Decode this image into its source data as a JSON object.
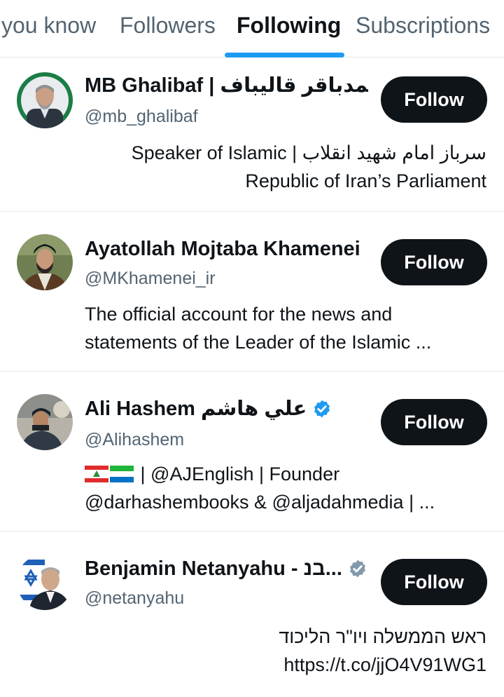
{
  "tabs": [
    {
      "label": "you know",
      "active": false
    },
    {
      "label": "Followers",
      "active": false
    },
    {
      "label": "Following",
      "active": true
    },
    {
      "label": "Subscriptions",
      "active": false
    }
  ],
  "colors": {
    "accent": "#1d9bf0",
    "text": "#0f1419",
    "secondary": "#536471",
    "button": "#0f1419",
    "divider": "#e6e9eb"
  },
  "accounts": [
    {
      "name": "MB Ghalibaf | محمدباقر قالیباف",
      "handle": "@mb_ghalibaf",
      "verified": false,
      "bio_lines": [
        "Speaker of Islamic | سرباز امام شهيد انقلاب",
        "Republic of Iran’s Parliament"
      ],
      "follow_label": "Follow"
    },
    {
      "name": "Ayatollah Mojtaba Khamenei",
      "handle": "@MKhamenei_ir",
      "verified": false,
      "bio_lines": [
        "The official account for the news and",
        "statements of the Leader of the Islamic ..."
      ],
      "follow_label": "Follow"
    },
    {
      "name": "Ali Hashem علي هاشم",
      "handle": "@Alihashem",
      "verified": true,
      "bio_flags": [
        "lebanon-flag",
        "sierra-leone-flag"
      ],
      "bio_lines": [
        "| @AJEnglish | Founder",
        "@darhashembooks & @aljadahmedia | ..."
      ],
      "follow_label": "Follow"
    },
    {
      "name": "Benjamin Netanyahu - בנ...",
      "handle": "@netanyahu",
      "verified": true,
      "bio_lines": [
        "ראש הממשלה ויו\"ר הליכוד",
        "https://t.co/jjO4V91WG1"
      ],
      "follow_label": "Follow"
    }
  ]
}
